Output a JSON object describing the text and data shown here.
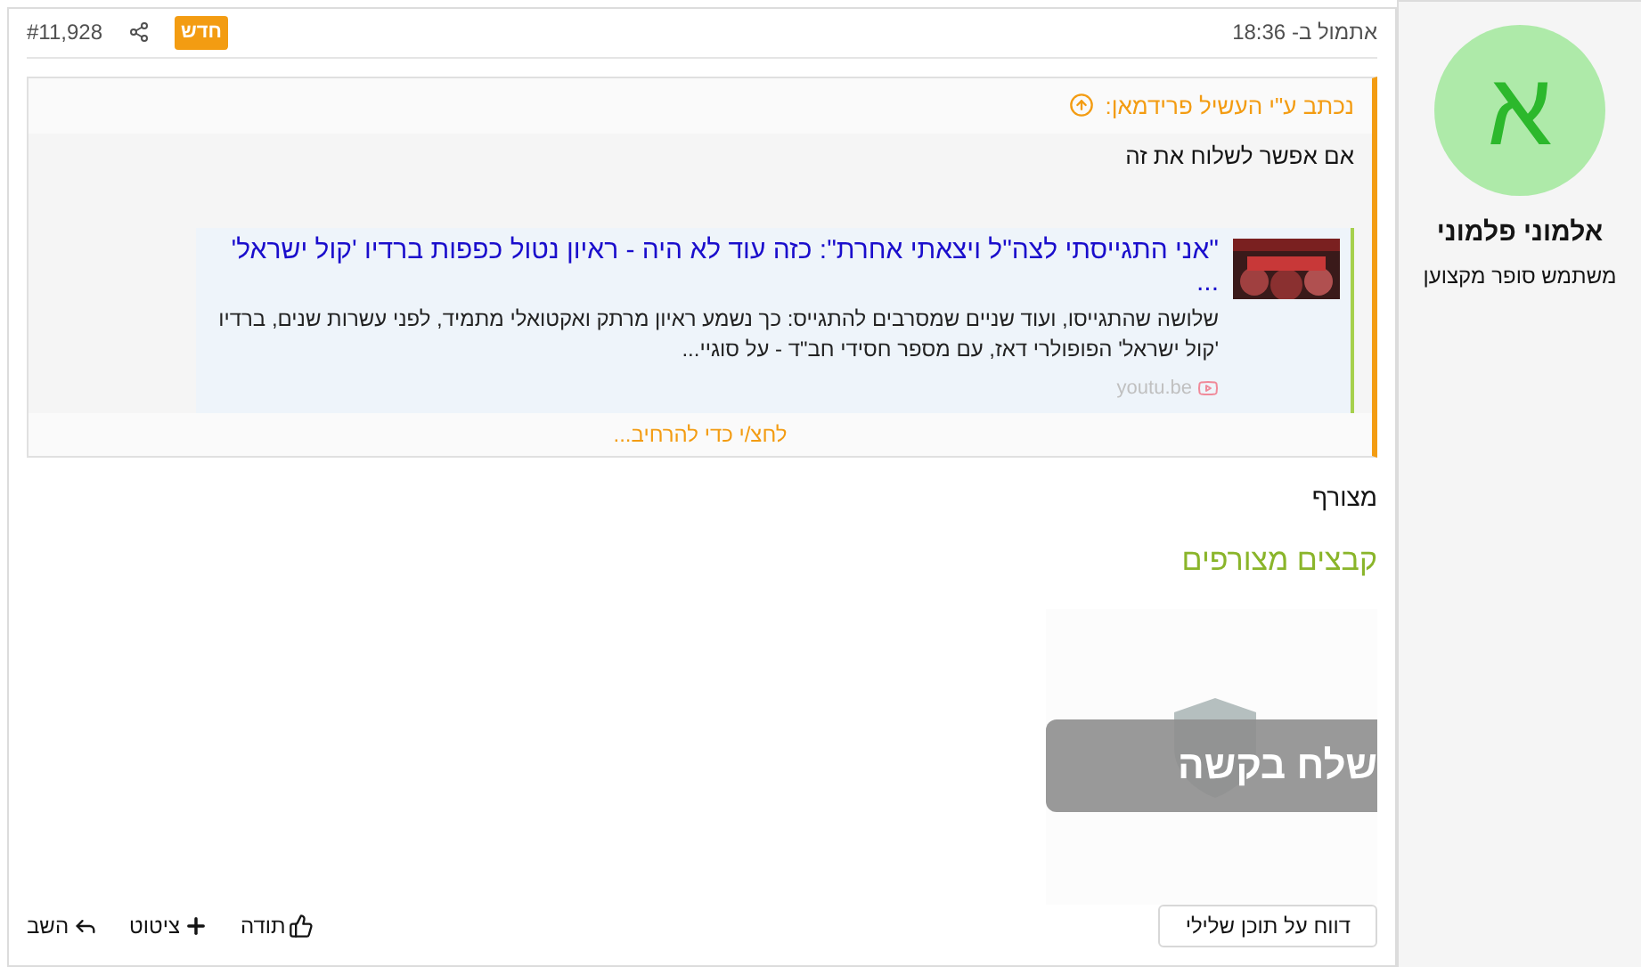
{
  "post": {
    "time": "אתמול ב- 18:36",
    "badge": "חדש",
    "number": "#11,928"
  },
  "user": {
    "avatar_letter": "א",
    "name": "אלמוני פלמוני",
    "title": "משתמש סופר מקצוען"
  },
  "quote": {
    "author": "נכתב ע\"י העשיל פרידמאן:",
    "text": "אם אפשר לשלוח את זה",
    "embed": {
      "title": "\"אני התגייסתי לצה\"ל ויצאתי אחרת\": כזה עוד לא היה - ראיון נטול כפפות ברדיו 'קול ישראל' ...",
      "description": "שלושה שהתגייסו, ועוד שניים שמסרבים להתגייס: כך נשמע ראיון מרתק ואקטואלי מתמיד, לפני עשרות שנים, ברדיו 'קול ישראל' הפופולרי דאז, עם מספר חסידי חב\"ד - על סוגיי...",
      "domain": "youtu.be"
    },
    "expand": "לחצ/י כדי להרחיב..."
  },
  "attachment_label": "מצורף",
  "attachments_title": "קבצים מצורפים",
  "blocked_button": "שלח בקשה",
  "report_button": "דווח על תוכן שלילי",
  "actions": [
    {
      "kind": "like",
      "label": "תודה"
    },
    {
      "kind": "quote",
      "label": "ציטוט"
    },
    {
      "kind": "reply",
      "label": "השב"
    }
  ]
}
